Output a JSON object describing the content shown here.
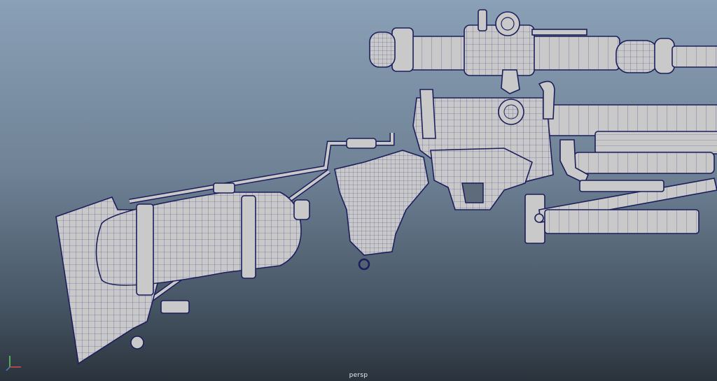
{
  "viewport": {
    "camera_label": "persp"
  },
  "axis_gizmo": {
    "x_color": "#d84a4a",
    "y_color": "#5fd35f",
    "z_color": "#4a7cd8"
  },
  "colors": {
    "background_top": "#8aa0b6",
    "background_bottom": "#2a333c",
    "mesh_fill": "#c9c9c9",
    "wireframe": "#1c1e5c"
  }
}
